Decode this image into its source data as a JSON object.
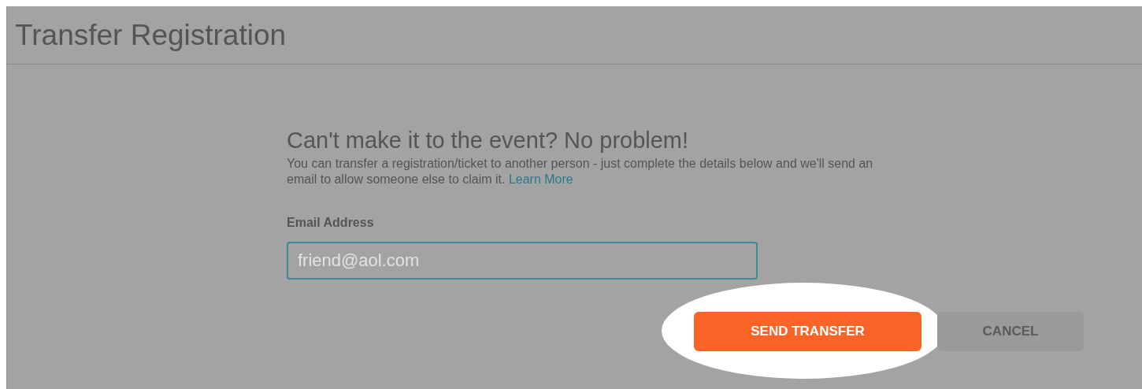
{
  "page": {
    "title": "Transfer Registration"
  },
  "intro": {
    "heading": "Can't make it to the event? No problem!",
    "text": "You can transfer a registration/ticket to another person - just complete the details below and we'll send an email to allow someone else to claim it.",
    "link": "Learn More"
  },
  "email_field": {
    "label": "Email Address",
    "placeholder": "friend@aol.com"
  },
  "buttons": [
    {
      "label": "SEND TRANSFER",
      "kind": "primary",
      "highlighted": true
    },
    {
      "label": "CANCEL",
      "kind": "secondary",
      "highlighted": false
    }
  ]
}
